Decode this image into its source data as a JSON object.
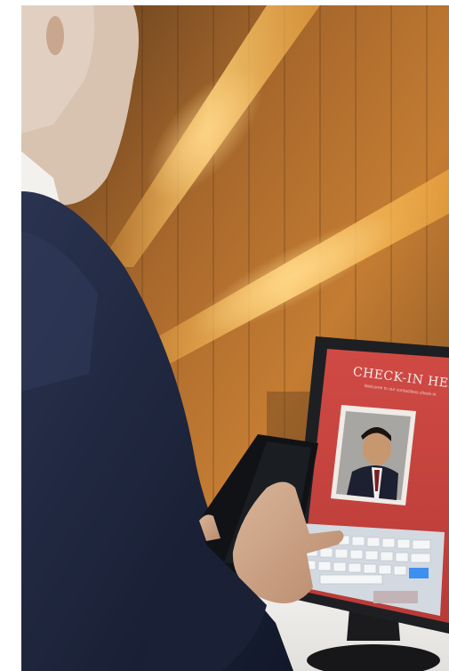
{
  "kiosk": {
    "logo_text": "",
    "title": "CHECK-IN HERE",
    "subtitle": "Welcome to our contactless check-in"
  },
  "colors": {
    "wall_wood": "#b8742a",
    "light_strip": "#ffc85a",
    "screen_red": "#c8443f",
    "suit_navy": "#1c2438",
    "keyboard": "#cfd6de"
  }
}
